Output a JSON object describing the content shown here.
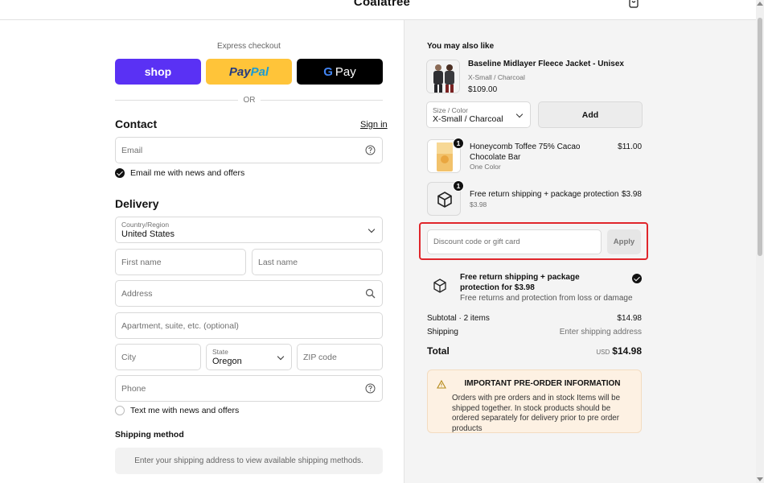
{
  "header": {
    "brand": "Coalatree",
    "cart_icon": "shopping-bag-icon"
  },
  "express": {
    "title": "Express checkout",
    "shop_label": "shop",
    "paypal_part1": "Pay",
    "paypal_part2": "Pal",
    "gpay_g": "G",
    "gpay_label": "Pay",
    "or": "OR"
  },
  "contact": {
    "title": "Contact",
    "signin": "Sign in",
    "email_placeholder": "Email",
    "newsletter_label": "Email me with news and offers"
  },
  "delivery": {
    "title": "Delivery",
    "country_label": "Country/Region",
    "country_value": "United States",
    "first_name": "First name",
    "last_name": "Last name",
    "address": "Address",
    "apartment": "Apartment, suite, etc. (optional)",
    "city": "City",
    "state_label": "State",
    "state_value": "Oregon",
    "zip": "ZIP code",
    "phone": "Phone",
    "sms_label": "Text me with news and offers"
  },
  "shipping": {
    "title": "Shipping method",
    "info": "Enter your shipping address to view available shipping methods."
  },
  "upsell": {
    "title": "You may also like",
    "name": "Baseline Midlayer Fleece Jacket - Unisex",
    "variant": "X-Small / Charcoal",
    "price": "$109.00",
    "size_label": "Size / Color",
    "size_value": "X-Small / Charcoal",
    "add_label": "Add"
  },
  "cart": {
    "items": [
      {
        "qty": "1",
        "name": "Honeycomb Toffee 75% Cacao Chocolate Bar",
        "sub": "One Color",
        "price": "$11.00"
      },
      {
        "qty": "1",
        "name": "Free return shipping + package protection",
        "sub": "$3.98",
        "price": "$3.98"
      }
    ]
  },
  "discount": {
    "placeholder": "Discount code or gift card",
    "apply": "Apply"
  },
  "protection": {
    "title": "Free return shipping + package protection for $3.98",
    "desc": "Free returns and protection from loss or damage"
  },
  "summary": {
    "subtotal_label": "Subtotal · 2 items",
    "subtotal_value": "$14.98",
    "shipping_label": "Shipping",
    "shipping_value": "Enter shipping address",
    "total_label": "Total",
    "currency": "USD",
    "total_value": "$14.98"
  },
  "notice": {
    "title": "IMPORTANT PRE-ORDER INFORMATION",
    "body": "Orders with pre orders and in stock Items will be shipped together. In stock products should be ordered separately for delivery prior to pre order products"
  },
  "colors": {
    "shop": "#5a31f4",
    "paypal": "#ffc439",
    "highlight": "#e0262b",
    "notice_bg": "#fdf1e3"
  }
}
